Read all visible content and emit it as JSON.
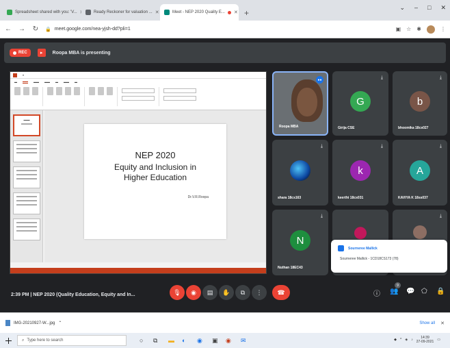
{
  "browser": {
    "tabs": [
      {
        "title": "Spreadsheet shared with you: 'V...",
        "color": "#34a853",
        "active": false
      },
      {
        "title": "Ready Reckoner for valuation ...",
        "color": "#5f6368",
        "active": false
      },
      {
        "title": "Meet - NEP 2020 Quality E...",
        "color": "#00897b",
        "active": true
      }
    ],
    "new_tab": "+",
    "url": "meet.google.com/nea-yjsh-dd?pli=1",
    "window_controls": [
      "⌄",
      "–",
      "□",
      "✕"
    ]
  },
  "meet": {
    "rec_label": "REC",
    "presenting_text": "Roopa MBA is presenting",
    "slide": {
      "title": "NEP 2020",
      "subtitle_line1": "Equity and Inclusion in",
      "subtitle_line2": "Higher Education",
      "author": "Dr.V.R.Roopa"
    },
    "participants": [
      {
        "name": "Roopa MBA",
        "initial": "",
        "color": "#6a6f73",
        "type": "video",
        "muted": false
      },
      {
        "name": "Girija CSE",
        "initial": "G",
        "color": "#34a853",
        "type": "avatar",
        "muted": true
      },
      {
        "name": "bhoomika 18cs027",
        "initial": "b",
        "color": "#795548",
        "type": "avatar",
        "muted": true
      },
      {
        "name": "shara 18cs163",
        "initial": "",
        "color": "#1a237e",
        "type": "photo",
        "muted": true
      },
      {
        "name": "keerthi 18cs031",
        "initial": "k",
        "color": "#9c27b0",
        "type": "avatar",
        "muted": true
      },
      {
        "name": "KAVIYA K 18ss037",
        "initial": "A",
        "color": "#26a69a",
        "type": "avatar",
        "muted": true
      },
      {
        "name": "Nuthan 18EC43",
        "initial": "N",
        "color": "#1e8e3e",
        "type": "avatar",
        "muted": true
      },
      {
        "name": "",
        "initial": "",
        "color": "#c2185b",
        "type": "avatar",
        "muted": false
      },
      {
        "name": "",
        "initial": "",
        "color": "#8d6e63",
        "type": "photo",
        "muted": true
      }
    ],
    "notification": {
      "title": "Sourneree Mallick",
      "message": "Sourneree Mallick - 1CD18CS173 (78)"
    },
    "meeting_info": "2:39 PM  |  NEP 2020 (Quality Education, Equity and In...",
    "people_count": "9"
  },
  "downloads": {
    "file_name": "IMG-20210927-W...jpg",
    "show_all": "Show all"
  },
  "taskbar": {
    "search_placeholder": "Type here to search",
    "time": "14:39",
    "date": "27-09-2021"
  }
}
